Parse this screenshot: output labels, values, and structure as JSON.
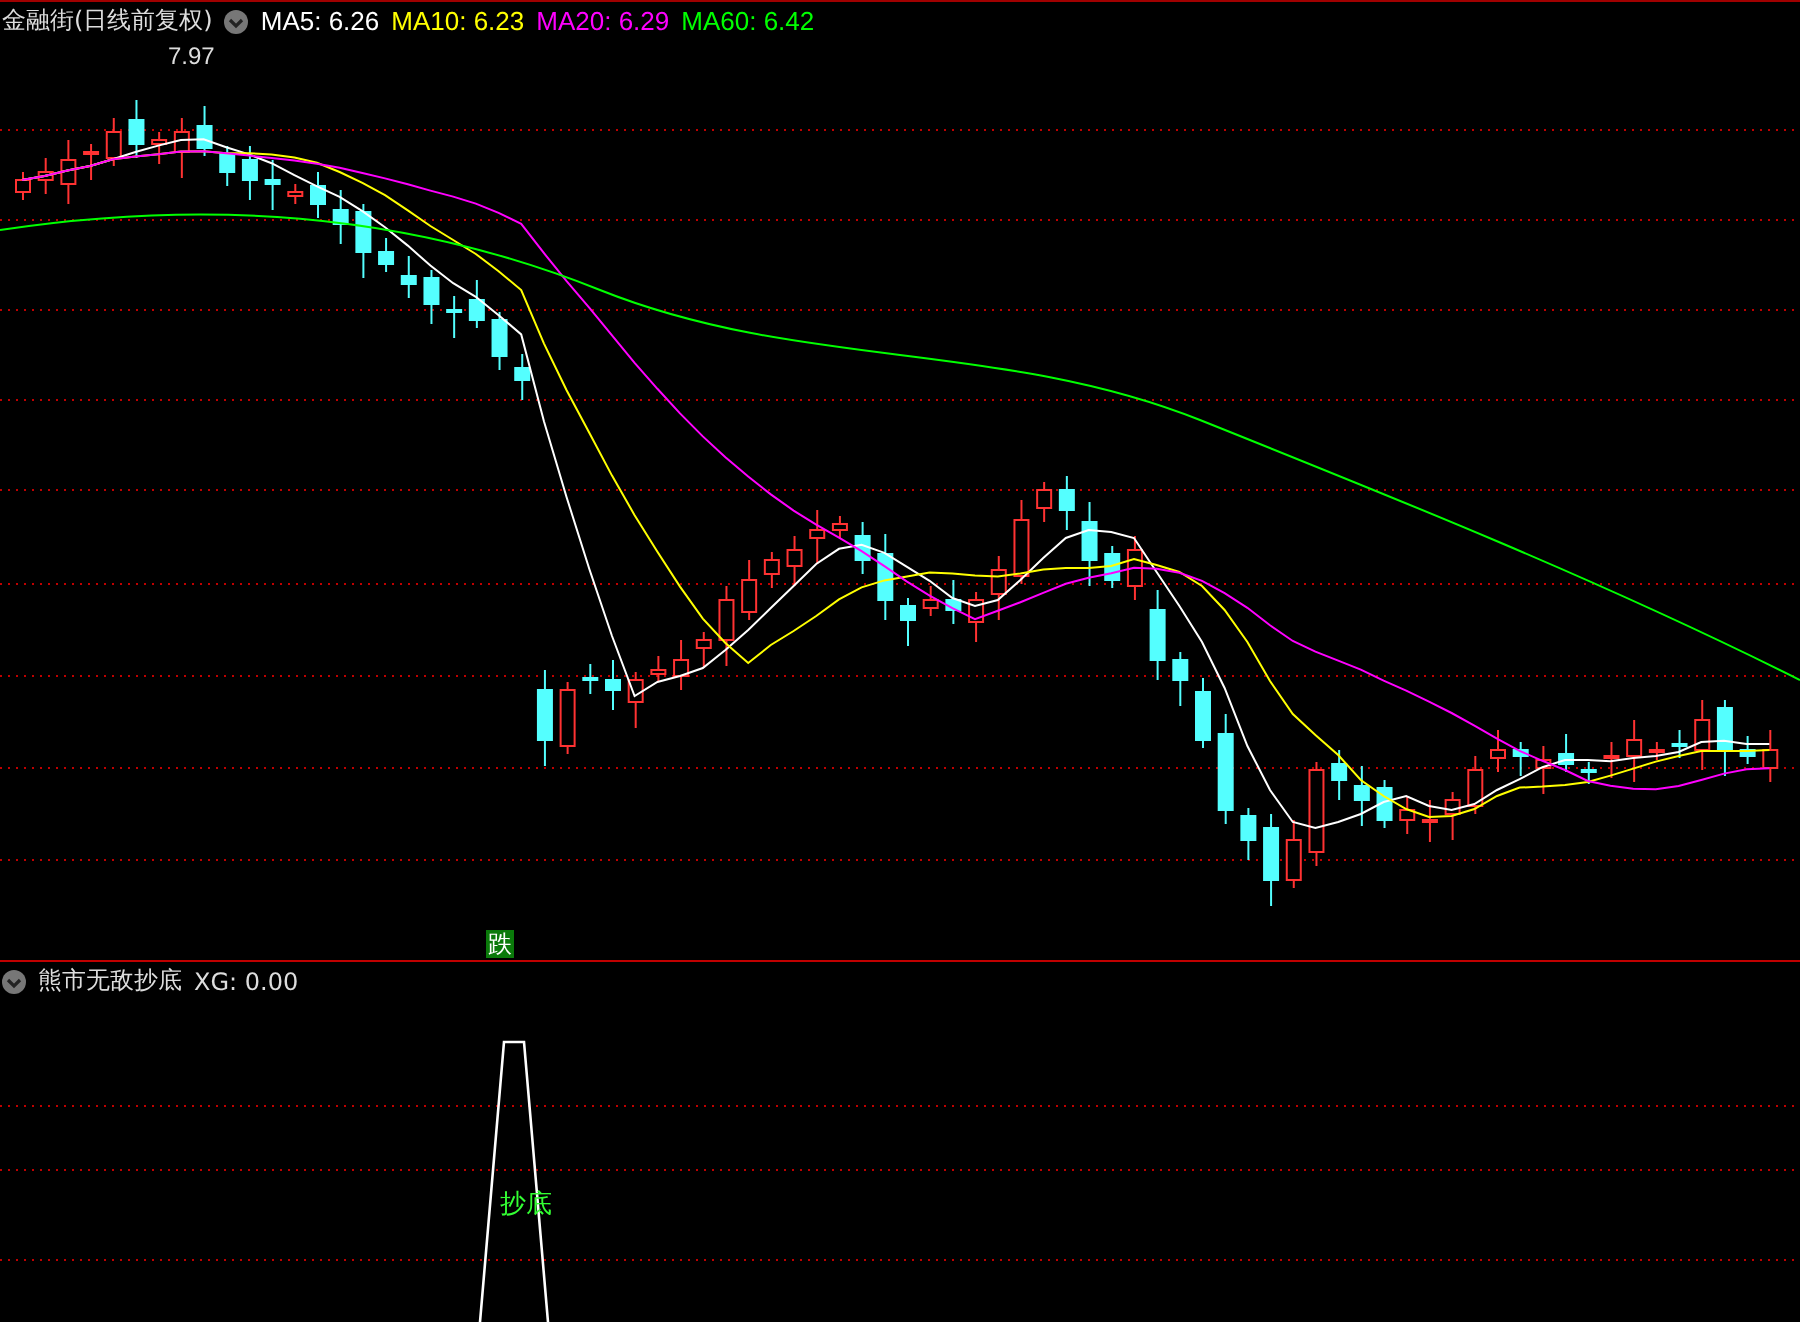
{
  "chart_header": {
    "title": "金融街(日线前复权)",
    "averages": [
      {
        "label": "MA5: 6.26",
        "color": "#ffffff"
      },
      {
        "label": "MA10: 6.23",
        "color": "#ffff00"
      },
      {
        "label": "MA20: 6.29",
        "color": "#ff00ff"
      },
      {
        "label": "MA60: 6.42",
        "color": "#00ff00"
      }
    ]
  },
  "price_chart": {
    "high_label": "7.97",
    "signal_label": "跌"
  },
  "indicator_header": {
    "title": "熊市无敌抄底",
    "reading": "XG: 0.00"
  },
  "indicator_chart": {
    "signal_label": "抄底"
  }
}
